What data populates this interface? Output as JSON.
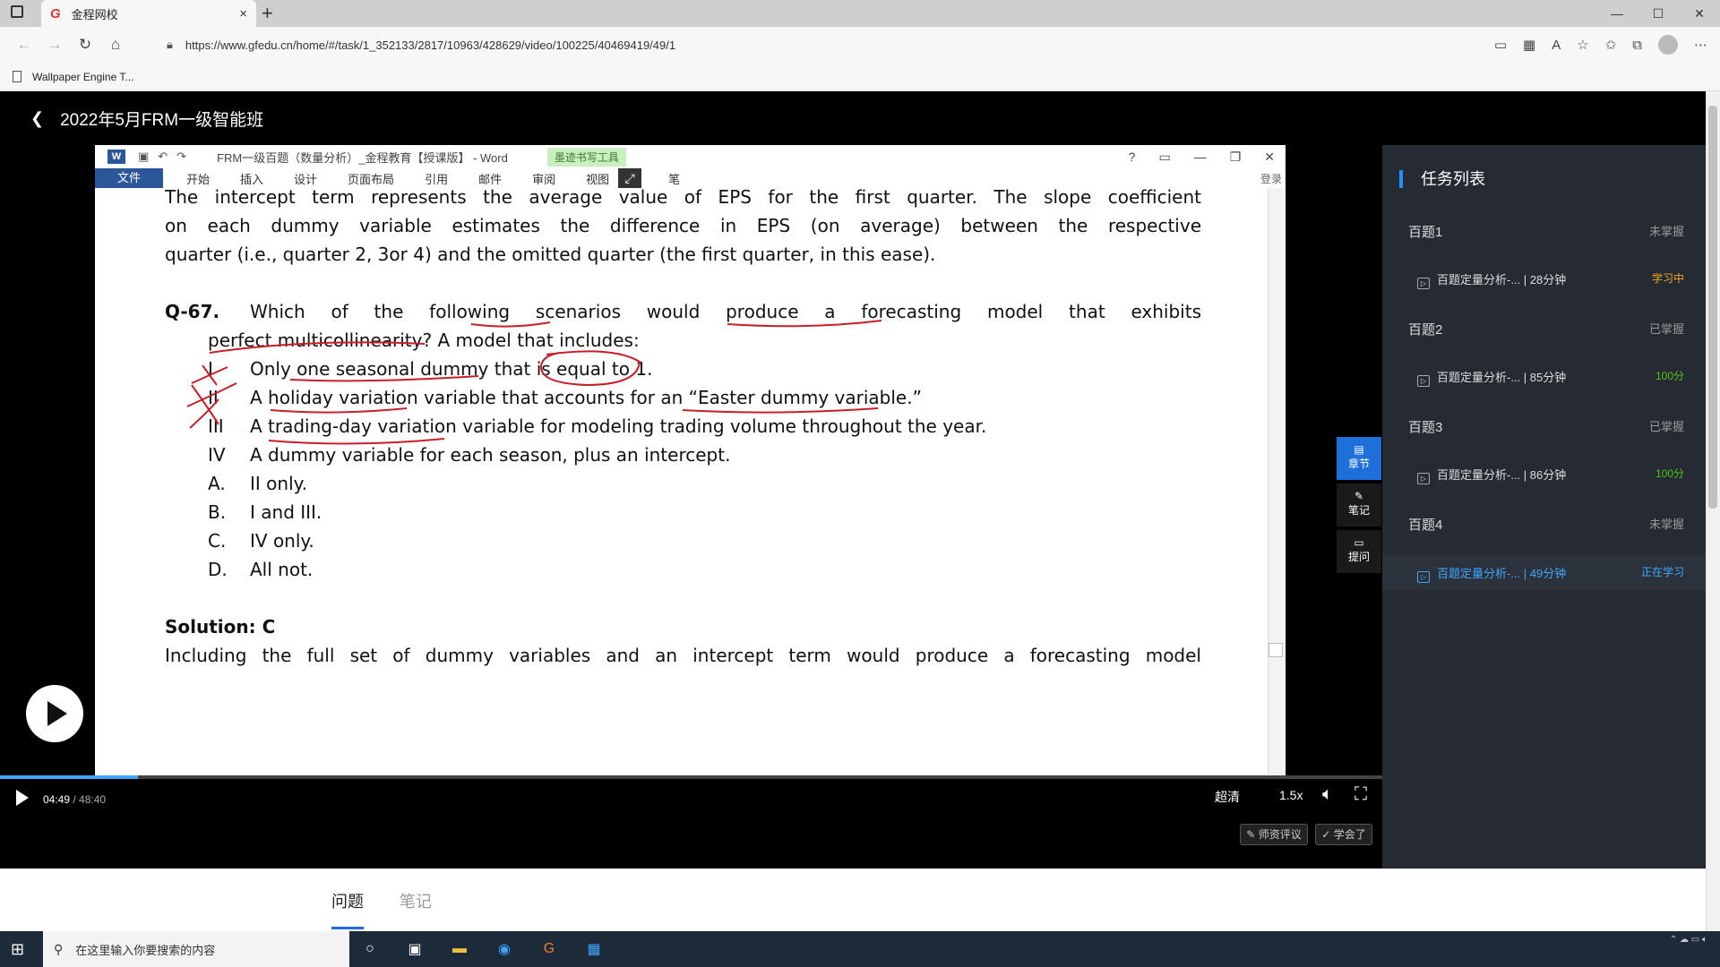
{
  "browser": {
    "tab_title": "金程网校",
    "tab_close": "×",
    "new_tab": "+",
    "url": "https://www.gfedu.cn/home/#/task/1_352133/2817/10963/428629/video/100225/40469419/49/1",
    "bookmark": "Wallpaper Engine T...",
    "window_controls": [
      "—",
      "☐",
      "✕"
    ]
  },
  "page": {
    "course_title": "2022年5月FRM一级智能班"
  },
  "word": {
    "title": "FRM一级百题（数量分析）_金程教育【授课版】 - Word",
    "ink_tools": "墨迹书写工具",
    "menu": [
      "文件",
      "开始",
      "插入",
      "设计",
      "页面布局",
      "引用",
      "邮件",
      "审阅",
      "视图",
      "笔"
    ],
    "login": "登录",
    "doc": {
      "p1": "The intercept term represents the average value of EPS for the first quarter. The slope coefficient",
      "p2": "on each dummy variable estimates the difference in EPS (on average) between the respective",
      "p3": "quarter (i.e., quarter 2, 3or 4) and the omitted quarter (the first quarter, in this ease).",
      "q_label": "Q-67.",
      "q1": "Which of the following scenarios would produce a forecasting model that exhibits",
      "q2": "perfect multicollinearity? A model that includes:",
      "options": [
        {
          "num": "I",
          "text": "Only one seasonal dummy that is equal to 1."
        },
        {
          "num": "II",
          "text": "A holiday variation variable that accounts for an “Easter dummy variable.”"
        },
        {
          "num": "III",
          "text": "A trading-day variation variable for modeling trading volume throughout the year."
        },
        {
          "num": "IV",
          "text": "A dummy variable for each season, plus an intercept."
        }
      ],
      "answers": [
        {
          "num": "A.",
          "text": "II only."
        },
        {
          "num": "B.",
          "text": "I and III."
        },
        {
          "num": "C.",
          "text": "IV only."
        },
        {
          "num": "D.",
          "text": "All not."
        }
      ],
      "solution": "Solution: C",
      "s1": "Including the full set of dummy variables and an intercept term would produce a forecasting model"
    }
  },
  "player": {
    "time_current": "04:49",
    "time_total": "48:40",
    "progress": 0.1,
    "quality": "超清",
    "speed": "1.5x",
    "btn_comment": "师资评议",
    "btn_learned": "学会了",
    "side_tools": [
      "章节",
      "笔记",
      "提问"
    ]
  },
  "panel": {
    "title": "任务列表",
    "sections": [
      {
        "name": "百题1",
        "status": "未掌握",
        "item": "百题定量分析-... | 28分钟",
        "item_status": "学习中",
        "item_color": "#f5a623"
      },
      {
        "name": "百题2",
        "status": "已掌握",
        "item": "百题定量分析-... | 85分钟",
        "item_status": "100分",
        "item_color": "#52c41a"
      },
      {
        "name": "百题3",
        "status": "已掌握",
        "item": "百题定量分析-... | 86分钟",
        "item_status": "100分",
        "item_color": "#52c41a"
      },
      {
        "name": "百题4",
        "status": "未掌握",
        "item": "百题定量分析-... | 49分钟",
        "item_status": "正在学习",
        "item_color": "#3ea6ff"
      }
    ]
  },
  "below_tabs": [
    "问题",
    "笔记"
  ],
  "taskbar": {
    "search_placeholder": "在这里输入你要搜索的内容"
  }
}
